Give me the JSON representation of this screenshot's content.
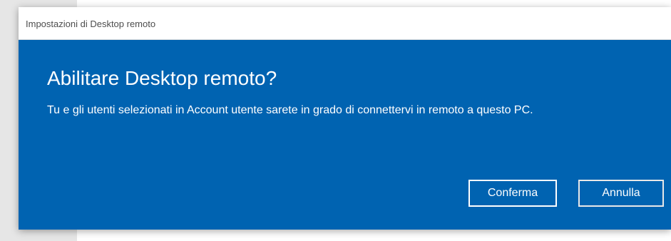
{
  "window": {
    "title": "Impostazioni di Desktop remoto"
  },
  "dialog": {
    "heading": "Abilitare Desktop remoto?",
    "message": "Tu e gli utenti selezionati in Account utente sarete in grado di connettervi in remoto a questo PC.",
    "confirm_label": "Conferma",
    "cancel_label": "Annulla"
  },
  "colors": {
    "accent": "#0063b1",
    "text_on_accent": "#ffffff",
    "titlebar_bg": "#ffffff",
    "titlebar_text": "#4d4d4d"
  }
}
